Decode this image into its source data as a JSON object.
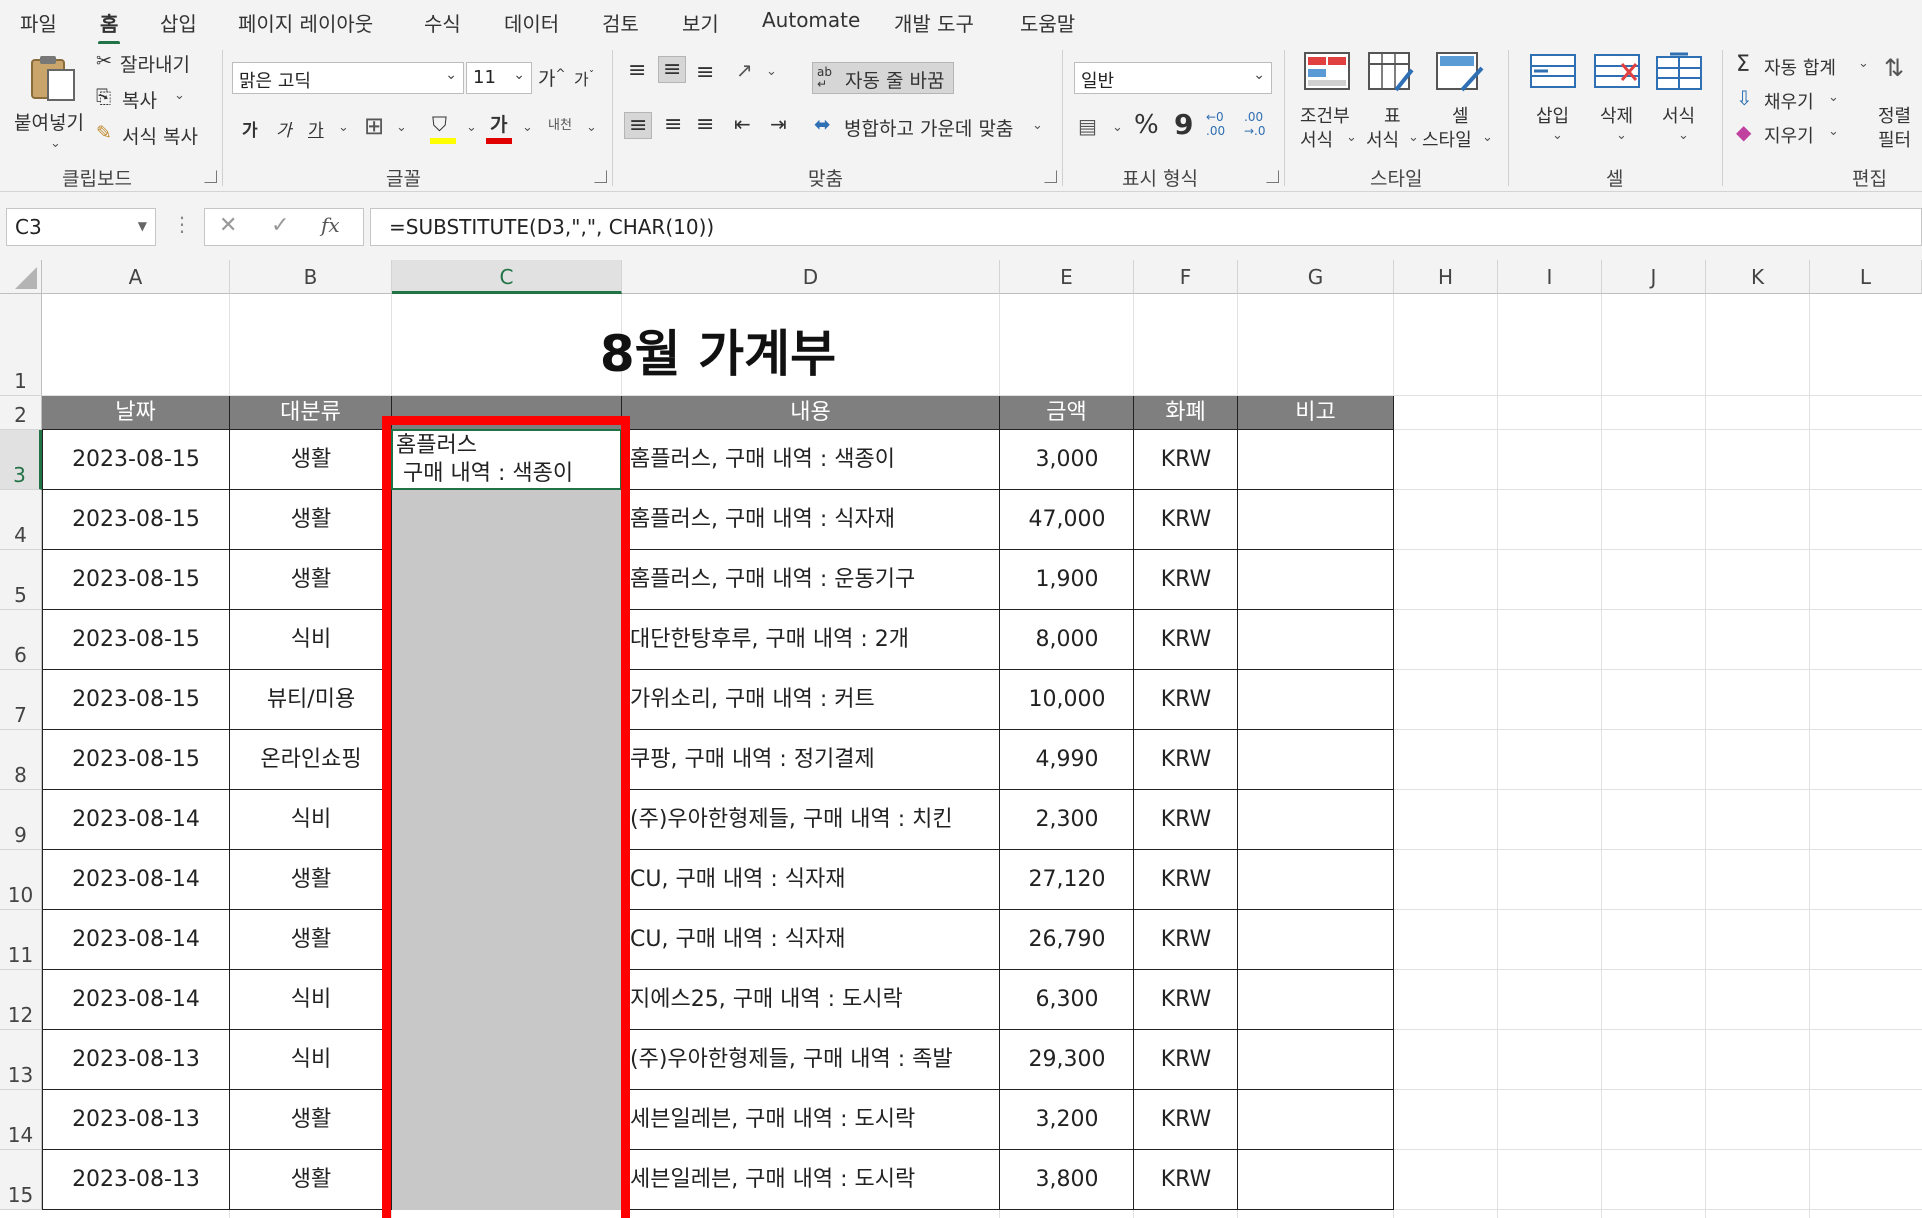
{
  "menu_tabs": [
    "파일",
    "홈",
    "삽입",
    "페이지 레이아웃",
    "수식",
    "데이터",
    "검토",
    "보기",
    "Automate",
    "개발 도구",
    "도움말"
  ],
  "active_tab": "홈",
  "ribbon": {
    "clipboard": {
      "paste": "붙여넣기",
      "cut": "잘라내기",
      "copy": "복사",
      "format_painter": "서식 복사",
      "label": "클립보드"
    },
    "font": {
      "font_name": "맑은 고딕",
      "font_size": "11",
      "grow": "가",
      "shrink": "가",
      "bold": "가",
      "italic": "가",
      "underline": "가",
      "font_color_glyph": "가",
      "phonetic": "내천",
      "label": "글꼴",
      "highlight_color": "#ffff00",
      "font_color": "#e00000"
    },
    "alignment": {
      "wrap_text": "자동 줄 바꿈",
      "merge_center": "병합하고 가운데 맞춤",
      "label": "맞춤"
    },
    "number": {
      "format": "일반",
      "percent": "%",
      "comma": "9",
      "label": "표시 형식"
    },
    "styles": {
      "conditional_1": "조건부",
      "conditional_2": "서식",
      "table_1": "표",
      "table_2": "서식",
      "cell_styles_1": "셀",
      "cell_styles_2": "스타일",
      "label": "스타일"
    },
    "cells": {
      "insert": "삽입",
      "delete": "삭제",
      "format": "서식",
      "label": "셀"
    },
    "editing": {
      "autosum": "자동 합계",
      "fill": "채우기",
      "clear": "지우기",
      "sort_1": "정렬",
      "sort_2": "필터",
      "label": "편집"
    }
  },
  "formula_bar": {
    "name_box": "C3",
    "fx": "fx",
    "formula": "=SUBSTITUTE(D3,\",\", CHAR(10))"
  },
  "columns": [
    "A",
    "B",
    "C",
    "D",
    "E",
    "F",
    "G",
    "H",
    "I",
    "J",
    "K",
    "L"
  ],
  "selected_column": "C",
  "rows": [
    "1",
    "2",
    "3",
    "4",
    "5",
    "6",
    "7",
    "8",
    "9",
    "10",
    "11",
    "12",
    "13",
    "14",
    "15"
  ],
  "sheet": {
    "title": "8월 가계부",
    "headers": [
      "날짜",
      "대분류",
      "",
      "내용",
      "금액",
      "화폐",
      "비고"
    ],
    "c3_line1": "홈플러스",
    "c3_line2": " 구매 내역 : 색종이",
    "data": [
      [
        "2023-08-15",
        "생활",
        "홈플러스, 구매 내역 : 색종이",
        "3,000",
        "KRW"
      ],
      [
        "2023-08-15",
        "생활",
        "홈플러스, 구매 내역 : 식자재",
        "47,000",
        "KRW"
      ],
      [
        "2023-08-15",
        "생활",
        "홈플러스, 구매 내역 : 운동기구",
        "1,900",
        "KRW"
      ],
      [
        "2023-08-15",
        "식비",
        "대단한탕후루, 구매 내역 :  2개",
        "8,000",
        "KRW"
      ],
      [
        "2023-08-15",
        "뷰티/미용",
        "가위소리, 구매 내역 : 커트",
        "10,000",
        "KRW"
      ],
      [
        "2023-08-15",
        "온라인쇼핑",
        "쿠팡, 구매 내역 : 정기결제",
        "4,990",
        "KRW"
      ],
      [
        "2023-08-14",
        "식비",
        "(주)우아한형제들, 구매 내역 : 치킨",
        "2,300",
        "KRW"
      ],
      [
        "2023-08-14",
        "생활",
        "CU, 구매 내역 : 식자재",
        "27,120",
        "KRW"
      ],
      [
        "2023-08-14",
        "생활",
        "CU, 구매 내역 : 식자재",
        "26,790",
        "KRW"
      ],
      [
        "2023-08-14",
        "식비",
        "지에스25, 구매 내역 : 도시락",
        "6,300",
        "KRW"
      ],
      [
        "2023-08-13",
        "식비",
        "(주)우아한형제들, 구매 내역 : 족발",
        "29,300",
        "KRW"
      ],
      [
        "2023-08-13",
        "생활",
        "세븐일레븐, 구매 내역 : 도시락",
        "3,200",
        "KRW"
      ],
      [
        "2023-08-13",
        "생활",
        "세븐일레븐, 구매 내역 : 도시락",
        "3,800",
        "KRW"
      ]
    ]
  },
  "colors": {
    "accent_green": "#217346",
    "header_fill": "#7f7f7f",
    "selection_fill": "#c8c8c8",
    "highlight_border": "#ff0000"
  }
}
